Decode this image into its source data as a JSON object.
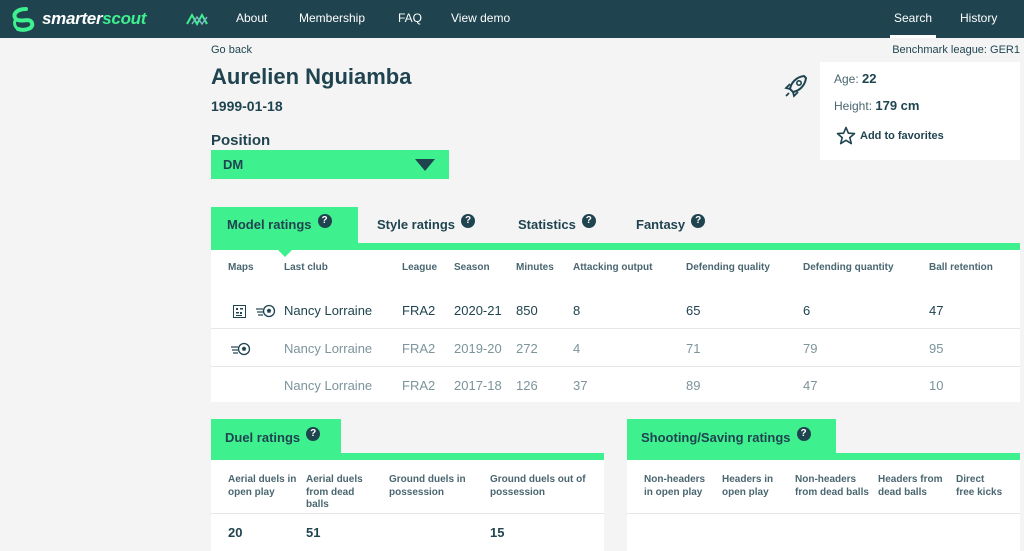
{
  "nav": {
    "logo_part1": "smarter",
    "logo_part2": "scout",
    "links": [
      "About",
      "Membership",
      "FAQ",
      "View demo"
    ],
    "right_links": [
      "Search",
      "History"
    ],
    "active": "Search"
  },
  "header": {
    "go_back": "Go back",
    "benchmark": "Benchmark league: GER1",
    "player_name": "Aurelien Nguiamba",
    "dob": "1999-01-18",
    "age_label": "Age:",
    "age": "22",
    "height_label": "Height:",
    "height": "179 cm",
    "favorites": "Add to favorites"
  },
  "position": {
    "label": "Position",
    "selected": "DM"
  },
  "tabs": [
    {
      "label": "Model ratings",
      "help": "?"
    },
    {
      "label": "Style ratings",
      "help": "?"
    },
    {
      "label": "Statistics",
      "help": "?"
    },
    {
      "label": "Fantasy",
      "help": "?"
    }
  ],
  "ratings_table": {
    "headers": [
      "Maps",
      "Last club",
      "League",
      "Season",
      "Minutes",
      "Attacking output",
      "Defending quality",
      "Defending quantity",
      "Ball retention"
    ],
    "rows": [
      {
        "club": "Nancy Lorraine",
        "league": "FRA2",
        "season": "2020-21",
        "minutes": "850",
        "attacking": "8",
        "def_quality": "65",
        "def_quantity": "6",
        "retention": "47"
      },
      {
        "club": "Nancy Lorraine",
        "league": "FRA2",
        "season": "2019-20",
        "minutes": "272",
        "attacking": "4",
        "def_quality": "71",
        "def_quantity": "79",
        "retention": "95"
      },
      {
        "club": "Nancy Lorraine",
        "league": "FRA2",
        "season": "2017-18",
        "minutes": "126",
        "attacking": "37",
        "def_quality": "89",
        "def_quantity": "47",
        "retention": "10"
      }
    ]
  },
  "duel": {
    "title": "Duel ratings",
    "help": "?",
    "headers": [
      "Aerial duels in open play",
      "Aerial duels from dead balls",
      "Ground duels in possession",
      "Ground duels out of possession"
    ],
    "values": [
      "20",
      "51",
      "",
      "15"
    ]
  },
  "shooting": {
    "title": "Shooting/Saving ratings",
    "help": "?",
    "headers": [
      "Non-headers in open play",
      "Headers in open play",
      "Non-headers from dead balls",
      "Headers from dead balls",
      "Direct free kicks"
    ]
  },
  "colors": {
    "navy": "#1f4450",
    "green": "#3ff08f",
    "background": "#f4f4f4"
  }
}
